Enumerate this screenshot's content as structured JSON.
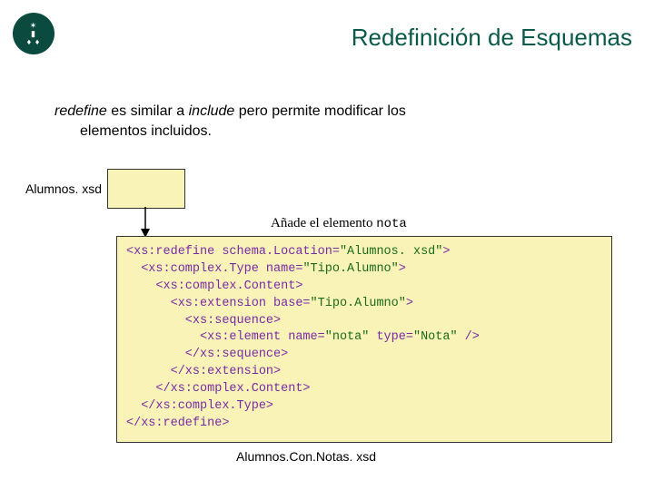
{
  "title": "Redefinición de Esquemas",
  "intro": {
    "kw1": "redefine",
    "mid1": " es similar a ",
    "kw2": "include",
    "mid2": " pero permite modificar los",
    "line2": "elementos incluidos."
  },
  "label_small": "Alumnos. xsd",
  "annotation": {
    "prefix": "Añade el elemento ",
    "code": "nota"
  },
  "code": {
    "l1a": "<xs:redefine schema.Location=",
    "l1b": "\"Alumnos. xsd\"",
    "l1c": ">",
    "l2a": "  <xs:complex.Type name=",
    "l2b": "\"Tipo.Alumno\"",
    "l2c": ">",
    "l3": "    <xs:complex.Content>",
    "l4a": "      <xs:extension base=",
    "l4b": "\"Tipo.Alumno\"",
    "l4c": ">",
    "l5": "        <xs:sequence>",
    "l6a": "          <xs:element name=",
    "l6b": "\"nota\"",
    "l6c": " type=",
    "l6d": "\"Nota\"",
    "l6e": " />",
    "l7": "        </xs:sequence>",
    "l8": "      </xs:extension>",
    "l9": "    </xs:complex.Content>",
    "l10": "  </xs:complex.Type>",
    "l11": "</xs:redefine>"
  },
  "label_bottom": "Alumnos.Con.Notas. xsd"
}
